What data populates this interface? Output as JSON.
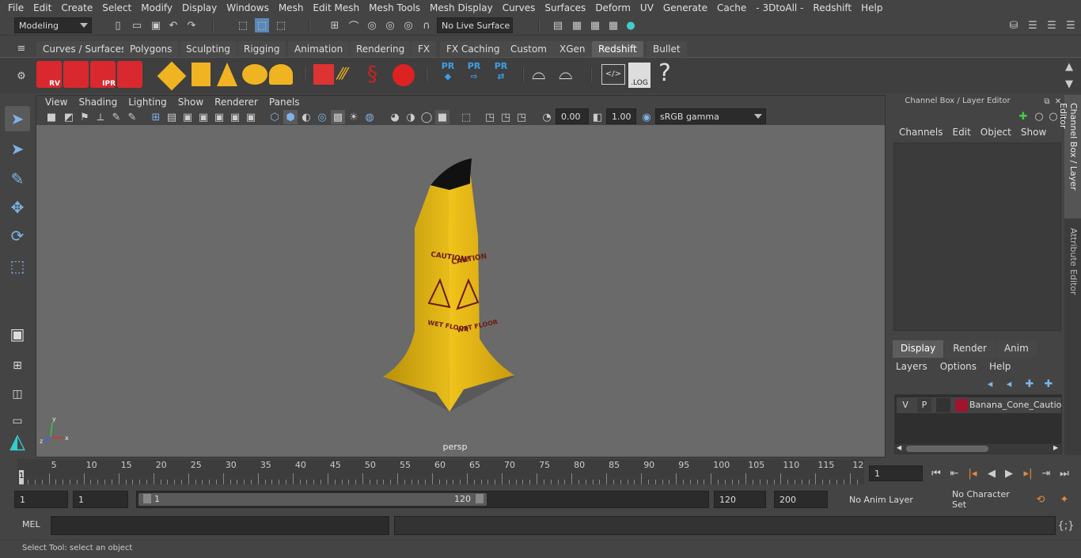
{
  "menubar": [
    "File",
    "Edit",
    "Create",
    "Select",
    "Modify",
    "Display",
    "Windows",
    "Mesh",
    "Edit Mesh",
    "Mesh Tools",
    "Mesh Display",
    "Curves",
    "Surfaces",
    "Deform",
    "UV",
    "Generate",
    "Cache",
    "- 3DtoAll -",
    "Redshift",
    "Help"
  ],
  "status": {
    "mode": "Modeling",
    "live_surface": "No Live Surface"
  },
  "shelf_tabs": [
    "Curves / Surfaces",
    "Polygons",
    "Sculpting",
    "Rigging",
    "Animation",
    "Rendering",
    "FX",
    "FX Caching",
    "Custom",
    "XGen",
    "Redshift",
    "Bullet"
  ],
  "active_shelf_tab": "Redshift",
  "shelf_icons": {
    "rv": "RV",
    "ipr": "IPR",
    "pr": "PR",
    "log": ".LOG",
    "help": "?"
  },
  "panel_menu": [
    "View",
    "Shading",
    "Lighting",
    "Show",
    "Renderer",
    "Panels"
  ],
  "panel_fields": {
    "exposure": "0.00",
    "gamma": "1.00",
    "colorspace": "sRGB gamma"
  },
  "viewport": {
    "camera": "persp",
    "cone_text_left": "CAUTION!",
    "cone_text_right": "CAUTION",
    "wet_floor": "WET FLOOR",
    "axis_x": "x",
    "axis_y": "y",
    "axis_z": "z"
  },
  "channelbox": {
    "title": "Channel Box / Layer Editor",
    "menus": [
      "Channels",
      "Edit",
      "Object",
      "Show"
    ],
    "tabs": [
      "Display",
      "Render",
      "Anim"
    ],
    "active_tab": "Display",
    "layer_menus": [
      "Layers",
      "Options",
      "Help"
    ],
    "layer": {
      "v": "V",
      "p": "P",
      "name": "Banana_Cone_Caution",
      "color": "#a0142e"
    }
  },
  "side_tabs": [
    "Channel Box / Layer Editor",
    "Attribute Editor"
  ],
  "timeline": {
    "ticks": [
      "5",
      "10",
      "15",
      "20",
      "25",
      "30",
      "35",
      "40",
      "45",
      "50",
      "55",
      "60",
      "65",
      "70",
      "75",
      "80",
      "85",
      "90",
      "95",
      "100",
      "105",
      "110",
      "115",
      "12"
    ],
    "current": "1",
    "frame_field": "1"
  },
  "range": {
    "start": "1",
    "start2": "1",
    "slider_start": "1",
    "slider_end": "120",
    "end": "120",
    "end2": "200",
    "anim_layer": "No Anim Layer",
    "char_set": "No Character Set"
  },
  "cmd": {
    "lang": "MEL"
  },
  "help": "Select Tool: select an object"
}
